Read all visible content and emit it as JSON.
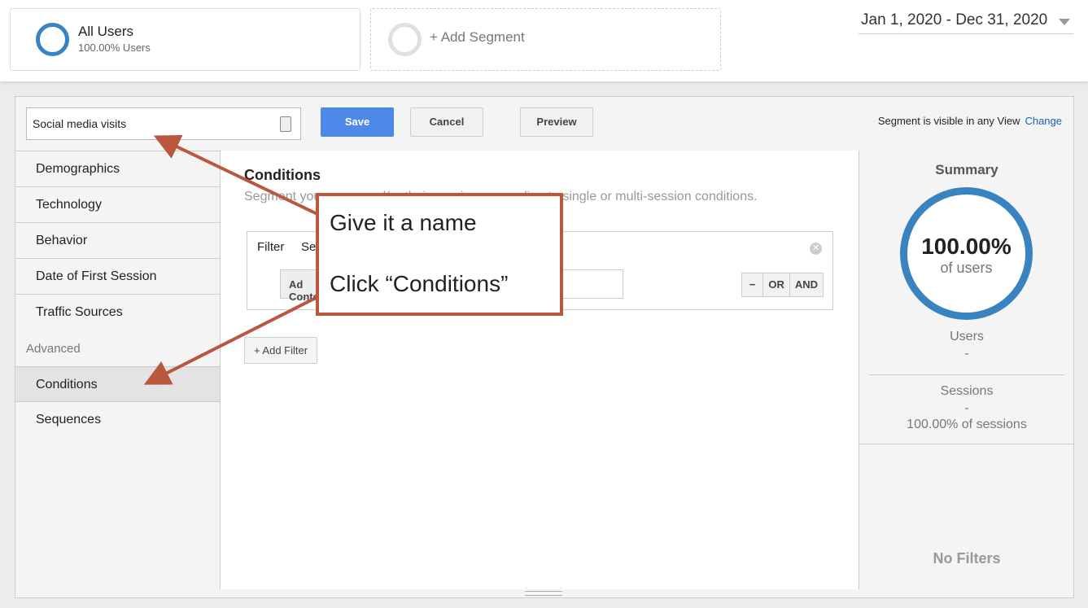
{
  "segments": [
    {
      "title": "All Users",
      "subtitle": "100.00% Users"
    },
    {
      "title": "+ Add Segment"
    }
  ],
  "date_range": "Jan 1, 2020 - Dec 31, 2020",
  "editor": {
    "name_value": "Social media visits",
    "save": "Save",
    "cancel": "Cancel",
    "preview": "Preview",
    "visibility": "Segment is visible in any View",
    "change": "Change",
    "side": [
      "Demographics",
      "Technology",
      "Behavior",
      "Date of First Session",
      "Traffic Sources"
    ],
    "advanced_label": "Advanced",
    "advanced": [
      "Conditions",
      "Sequences"
    ],
    "main": {
      "title": "Conditions",
      "desc": "Segment your users and/or their sessions according to single or multi-session conditions.",
      "filter_label": "Filter",
      "filter_scope": "Sessions",
      "dimension": "Ad Content",
      "ops": [
        "−",
        "OR",
        "AND"
      ],
      "add_filter": "+ Add Filter"
    },
    "summary": {
      "title": "Summary",
      "percent": "100.00%",
      "of_users": "of users",
      "users_label": "Users",
      "users_value": "-",
      "sessions_label": "Sessions",
      "sessions_value": "-",
      "sessions_pct": "100.00% of sessions",
      "no_filters": "No Filters"
    }
  },
  "callout": {
    "line1": "Give it a name",
    "line2": "Click “Conditions”"
  },
  "colors": {
    "accent": "#4d8ae8",
    "ring": "#3a83c1",
    "annotation": "#b9573f"
  }
}
